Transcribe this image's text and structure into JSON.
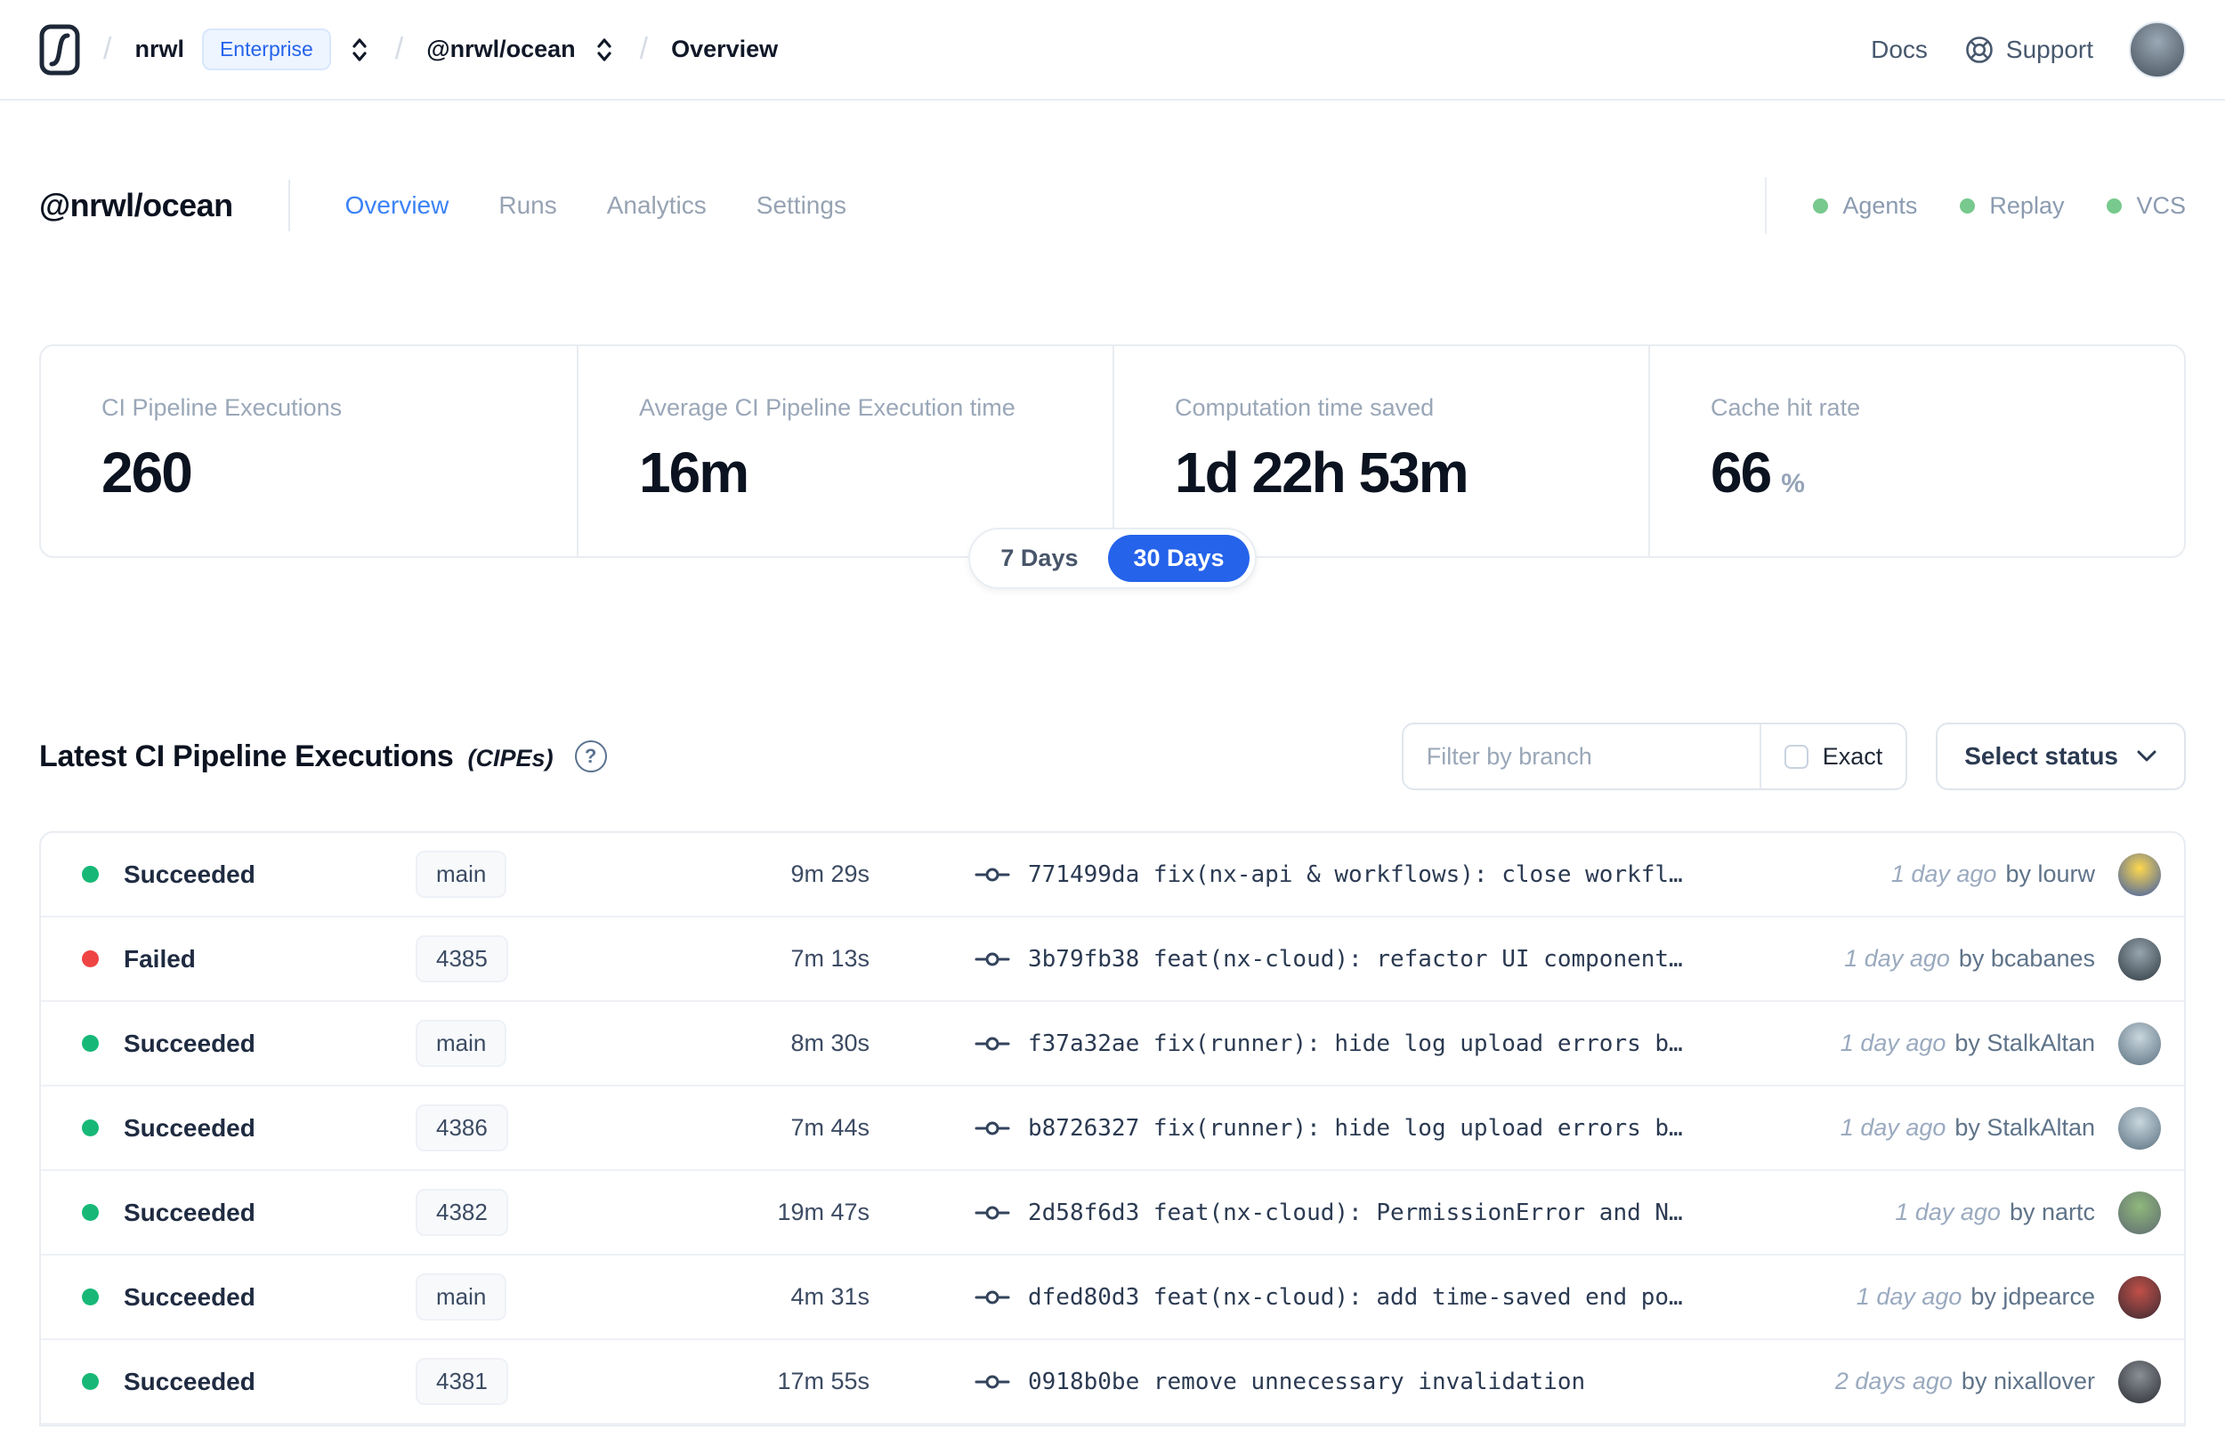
{
  "topbar": {
    "breadcrumb": {
      "separator": "/",
      "org": "nrwl",
      "org_badge": "Enterprise",
      "workspace": "@nrwl/ocean",
      "page": "Overview"
    },
    "links": {
      "docs": "Docs",
      "support": "Support"
    },
    "icons": {
      "logo": "nx-cloud-logo",
      "switcher": "chevron-up-down",
      "support": "lifebuoy"
    },
    "avatar_colors": [
      "#9aa8b5",
      "#46525c"
    ]
  },
  "workspace_header": {
    "title": "@nrwl/ocean",
    "tabs": [
      {
        "label": "Overview",
        "active": true
      },
      {
        "label": "Runs",
        "active": false
      },
      {
        "label": "Analytics",
        "active": false
      },
      {
        "label": "Settings",
        "active": false
      }
    ],
    "status_dot_color": "#77c98d",
    "status_indicators": [
      {
        "label": "Agents"
      },
      {
        "label": "Replay"
      },
      {
        "label": "VCS"
      }
    ]
  },
  "stats": {
    "cards": [
      {
        "label": "CI Pipeline Executions",
        "value": "260",
        "suffix": ""
      },
      {
        "label": "Average CI Pipeline Execution time",
        "value": "16m",
        "suffix": ""
      },
      {
        "label": "Computation time saved",
        "value": "1d 22h 53m",
        "suffix": ""
      },
      {
        "label": "Cache hit rate",
        "value": "66",
        "suffix": "%"
      }
    ],
    "range_toggle": {
      "options": [
        "7 Days",
        "30 Days"
      ],
      "selected": "30 Days"
    }
  },
  "cipes": {
    "title": "Latest CI Pipeline Executions",
    "title_suffix": "(CIPEs)",
    "help_glyph": "?",
    "filter": {
      "placeholder": "Filter by branch",
      "exact_label": "Exact",
      "exact_checked": false
    },
    "status_select": {
      "label": "Select status"
    },
    "rows": [
      {
        "status": "Succeeded",
        "status_color": "#17b877",
        "branch": "main",
        "duration": "9m 29s",
        "commit": "771499da fix(nx-api & workflows): close workfl…",
        "time_ago": "1 day ago",
        "author": "by lourw",
        "avatar_colors": [
          "#ffd84d",
          "#3b5ba8"
        ]
      },
      {
        "status": "Failed",
        "status_color": "#ef4444",
        "branch": "4385",
        "duration": "7m 13s",
        "commit": "3b79fb38 feat(nx-cloud): refactor UI component…",
        "time_ago": "1 day ago",
        "author": "by bcabanes",
        "avatar_colors": [
          "#97a5ae",
          "#2f3a42"
        ]
      },
      {
        "status": "Succeeded",
        "status_color": "#17b877",
        "branch": "main",
        "duration": "8m 30s",
        "commit": "f37a32ae fix(runner): hide log upload errors b…",
        "time_ago": "1 day ago",
        "author": "by StalkAltan",
        "avatar_colors": [
          "#c9d6dd",
          "#5a7080"
        ]
      },
      {
        "status": "Succeeded",
        "status_color": "#17b877",
        "branch": "4386",
        "duration": "7m 44s",
        "commit": "b8726327 fix(runner): hide log upload errors b…",
        "time_ago": "1 day ago",
        "author": "by StalkAltan",
        "avatar_colors": [
          "#c9d6dd",
          "#5a7080"
        ]
      },
      {
        "status": "Succeeded",
        "status_color": "#17b877",
        "branch": "4382",
        "duration": "19m 47s",
        "commit": "2d58f6d3 feat(nx-cloud): PermissionError and N…",
        "time_ago": "1 day ago",
        "author": "by nartc",
        "avatar_colors": [
          "#8fb87b",
          "#5f6b72"
        ]
      },
      {
        "status": "Succeeded",
        "status_color": "#17b877",
        "branch": "main",
        "duration": "4m 31s",
        "commit": "dfed80d3 feat(nx-cloud): add time-saved end po…",
        "time_ago": "1 day ago",
        "author": "by jdpearce",
        "avatar_colors": [
          "#c25048",
          "#3a2b33"
        ]
      },
      {
        "status": "Succeeded",
        "status_color": "#17b877",
        "branch": "4381",
        "duration": "17m 55s",
        "commit": "0918b0be remove unnecessary invalidation",
        "time_ago": "2 days ago",
        "author": "by nixallover",
        "avatar_colors": [
          "#8a8f96",
          "#2b2e33"
        ]
      }
    ]
  }
}
